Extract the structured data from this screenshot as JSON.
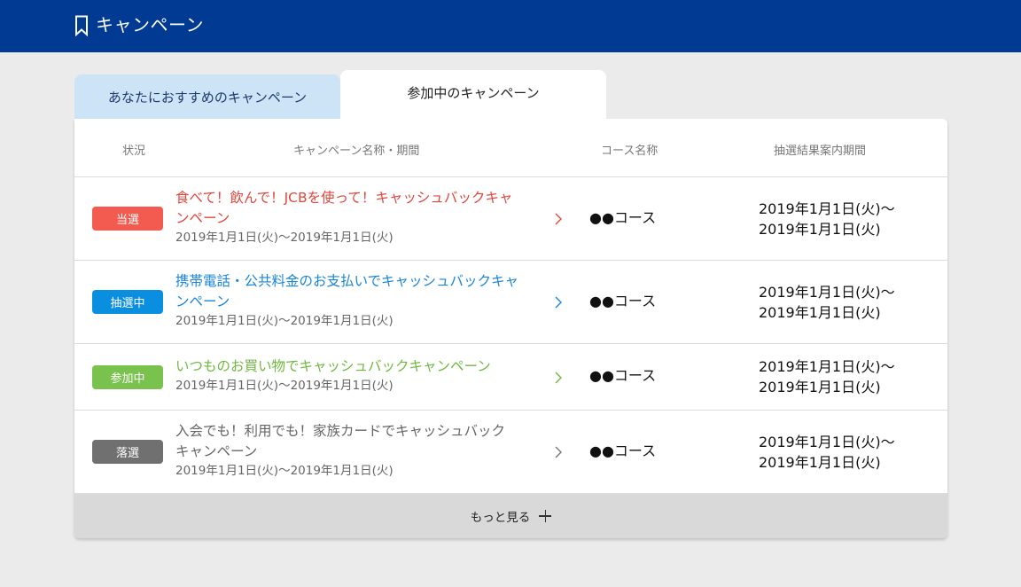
{
  "header": {
    "title": "キャンペーン"
  },
  "tabs": [
    {
      "label": "あなたにおすすめのキャンペーン",
      "active": false
    },
    {
      "label": "参加中のキャンペーン",
      "active": true
    }
  ],
  "table": {
    "columns": {
      "status": "状況",
      "name": "キャンペーン名称・期間",
      "course": "コース名称",
      "result": "抽選結果案内期間"
    },
    "rows": [
      {
        "status": "当選",
        "status_color": "#f35a50",
        "name_line1": "食べて！飲んで！JCBを使って！キャッシュバックキャ",
        "name_line2": "ンペーン",
        "name_color": "#e0463c",
        "period": "2019年1月1日(火)〜2019年1月1日(火)",
        "course": "●●コース",
        "result_line1": "2019年1月1日(火)〜",
        "result_line2": "2019年1月1日(火)",
        "chevron_color": "#e0463c"
      },
      {
        "status": "抽選中",
        "status_color": "#0a8ee0",
        "name_line1": "携帯電話・公共料金のお支払いでキャッシュバックキャ",
        "name_line2": "ンペーン",
        "name_color": "#1a86d6",
        "period": "2019年1月1日(火)〜2019年1月1日(火)",
        "course": "●●コース",
        "result_line1": "2019年1月1日(火)〜",
        "result_line2": "2019年1月1日(火)",
        "chevron_color": "#1a86d6"
      },
      {
        "status": "参加中",
        "status_color": "#7ac24e",
        "name_line1": "いつものお買い物でキャッシュバックキャンペーン",
        "name_line2": "",
        "name_color": "#6fb83f",
        "period": "2019年1月1日(火)〜2019年1月1日(火)",
        "course": "●●コース",
        "result_line1": "2019年1月1日(火)〜",
        "result_line2": "2019年1月1日(火)",
        "chevron_color": "#6fb83f"
      },
      {
        "status": "落選",
        "status_color": "#707070",
        "name_line1": "入会でも！利用でも！家族カードでキャッシュバック",
        "name_line2": "キャンペーン",
        "name_color": "#666666",
        "period": "2019年1月1日(火)〜2019年1月1日(火)",
        "course": "●●コース",
        "result_line1": "2019年1月1日(火)〜",
        "result_line2": "2019年1月1日(火)",
        "chevron_color": "#777777"
      }
    ]
  },
  "more_label": "もっと見る",
  "colors": {
    "header_bg": "#003a93",
    "tab_inactive_bg": "#cde3f6",
    "page_bg": "#ebebeb"
  }
}
